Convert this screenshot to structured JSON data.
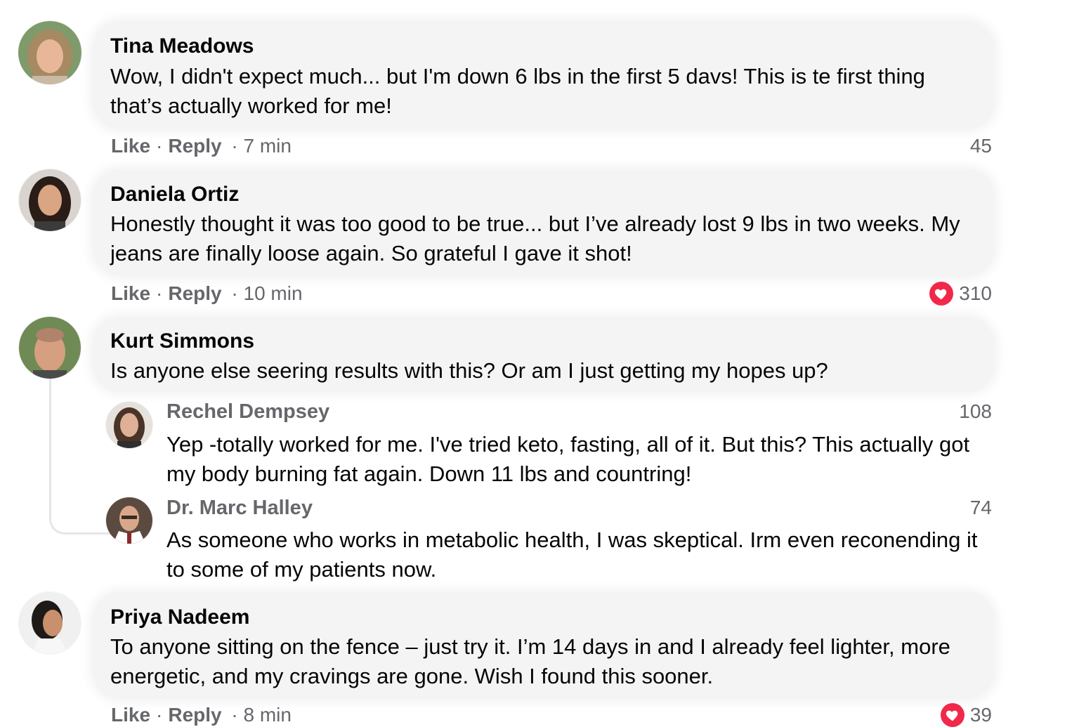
{
  "comments": [
    {
      "name": "Tina Meadows",
      "text": "Wow, I didn't expect much... but I'm down 6 lbs in the first 5 davs! This is te first thing that’s actually worked for me!",
      "like": "Like",
      "reply": "Reply",
      "dot": "·",
      "time": "· 7 min",
      "count": "45"
    },
    {
      "name": "Daniela Ortiz",
      "text": "Honestly thought it was too good to be true... but I’ve already lost 9 lbs in two weeks. My jeans are finally loose again. So grateful I gave it shot!",
      "like": "Like",
      "reply": "Reply",
      "dot": "·",
      "time": "· 10 min",
      "count": "310"
    },
    {
      "name": "Kurt Simmons",
      "text": "Is anyone else seering results with this? Or am I just getting my hopes up?"
    },
    {
      "name": "Priya Nadeem",
      "text": "To anyone sitting on the fence – just try it. I’m 14 days in and I already feel lighter, more energetic, and my cravings are gone. Wish I found this sooner.",
      "like": "Like",
      "reply": "Reply",
      "dot": "·",
      "time": "· 8 min",
      "count": "39"
    }
  ],
  "replies": [
    {
      "name": "Rechel Dempsey",
      "text": "Yep -totally worked for me. I've tried keto, fasting, all of it. But this? This actually got my body burning fat again. Down 11 lbs and countring!",
      "count": "108"
    },
    {
      "name": "Dr. Marc Halley",
      "text": "As someone who works in metabolic health, I was skeptical. Irm even reconending it to some of my patients now.",
      "count": "74"
    }
  ],
  "icons": {
    "reaction": "heart-icon",
    "reaction_color": "#f02849"
  }
}
